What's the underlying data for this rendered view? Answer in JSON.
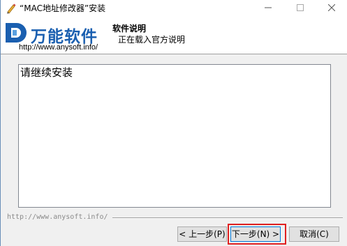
{
  "window": {
    "title": "“MAC地址修改器”安装",
    "app_icon": "installer-pen-icon",
    "controls": {
      "minimize": "minimize-icon",
      "maximize": "maximize-icon",
      "close": "close-icon"
    }
  },
  "header": {
    "logo_text": "万能软件",
    "logo_url": "http://www.anysoft.info/",
    "title": "软件说明",
    "subtitle": "正在载入官方说明"
  },
  "content": {
    "text": "请继续安装"
  },
  "footer": {
    "url": "http://www.anysoft.info/",
    "buttons": {
      "back": "< 上一步(P)",
      "next": "下一步(N) >",
      "cancel": "取消(C)"
    }
  },
  "colors": {
    "logo_blue": "#1a5fb0",
    "highlight_red": "#e02020",
    "focus_blue": "#0078d7"
  }
}
